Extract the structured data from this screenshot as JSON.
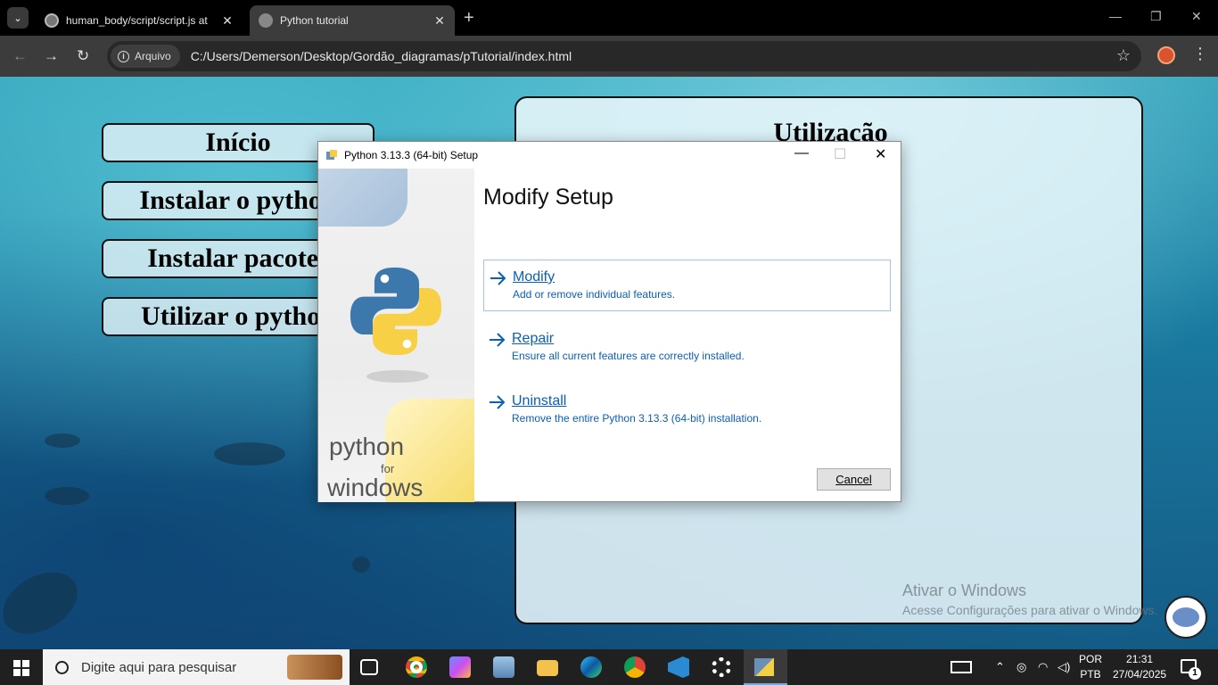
{
  "browser": {
    "tabs": [
      {
        "title": "human_body/script/script.js at",
        "active": false
      },
      {
        "title": "Python tutorial",
        "active": true
      }
    ],
    "address_badge": "Arquivo",
    "url": "C:/Users/Demerson/Desktop/Gordão_diagramas/pTutorial/index.html",
    "icons": {
      "back": "←",
      "forward": "→",
      "reload": "↻",
      "star": "☆",
      "menu": "⋮",
      "new_tab": "+",
      "minimize": "—",
      "restore": "❐",
      "close": "✕",
      "tab_close": "✕",
      "tab_menu": "⌄"
    }
  },
  "page": {
    "nav_buttons": [
      "Início",
      "Instalar o python",
      "Instalar pacotes",
      "Utilizar o python"
    ],
    "content_title": "Utilização",
    "watermark": {
      "title": "Ativar o Windows",
      "subtitle": "Acesse Configurações para ativar o Windows."
    }
  },
  "dialog": {
    "title": "Python 3.13.3 (64-bit) Setup",
    "controls": {
      "minimize": "—",
      "maximize": "☐",
      "close": "✕"
    },
    "heading": "Modify Setup",
    "side_text": {
      "line1": "python",
      "line2": "for",
      "line3": "windows"
    },
    "options": [
      {
        "title": "Modify",
        "description": "Add or remove individual features.",
        "selected": true
      },
      {
        "title": "Repair",
        "description": "Ensure all current features are correctly installed.",
        "selected": false
      },
      {
        "title": "Uninstall",
        "description": "Remove the entire Python 3.13.3 (64-bit) installation.",
        "selected": false
      }
    ],
    "cancel_label": "Cancel",
    "colors": {
      "link": "#0b5fb5",
      "logo_blue": "#3d78ad",
      "logo_yellow": "#f7d046"
    }
  },
  "taskbar": {
    "search_placeholder": "Digite aqui para pesquisar",
    "pinned": [
      "task-view",
      "chrome",
      "copilot",
      "photos",
      "file-explorer",
      "edge",
      "chrome-profile",
      "vscode",
      "settings",
      "python-setup"
    ],
    "language": {
      "line1": "POR",
      "line2": "PTB"
    },
    "time": "21:31",
    "date": "27/04/2025",
    "notification_count": "1"
  }
}
